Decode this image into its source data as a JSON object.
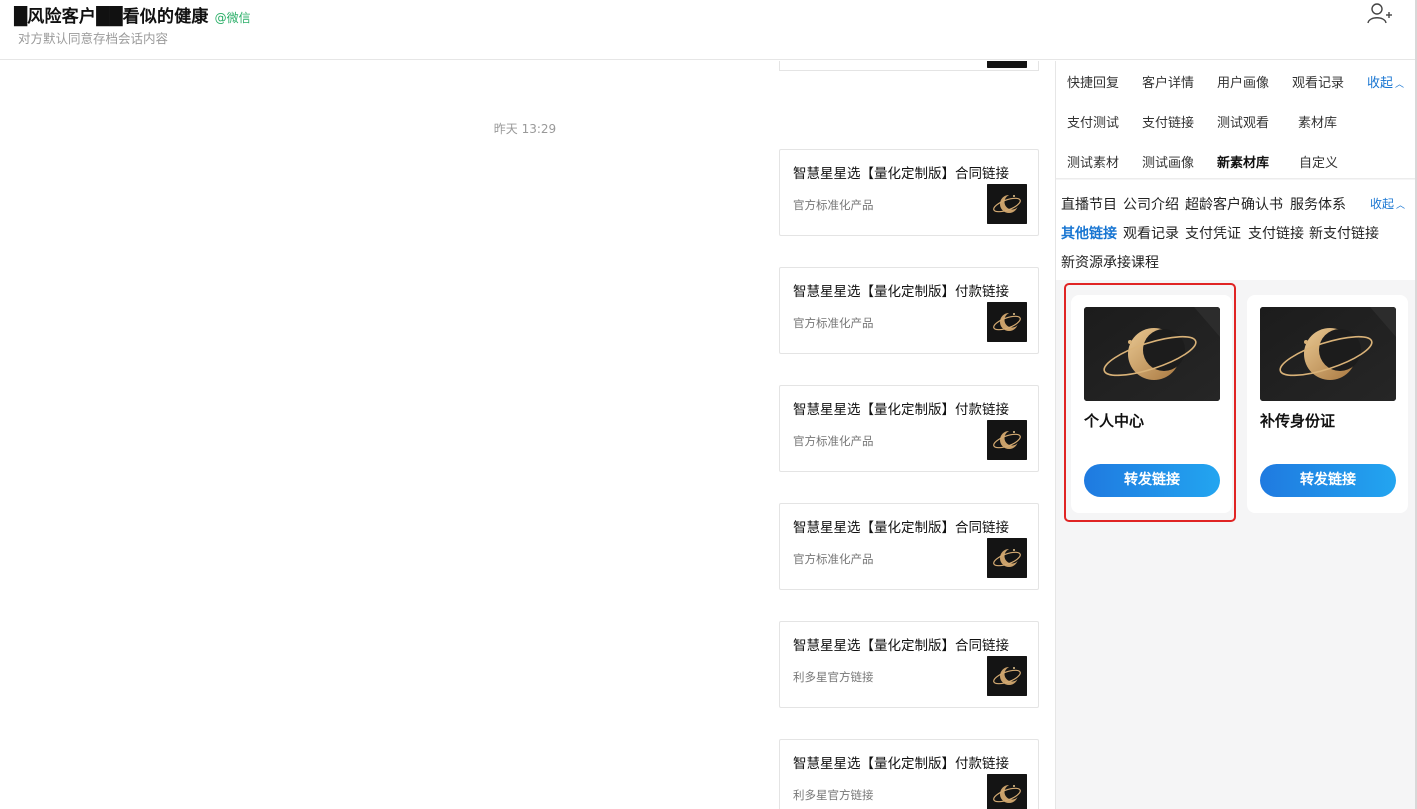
{
  "header": {
    "title": "█风险客户██看似的健康",
    "channel_tag": "@微信",
    "subtitle": "对方默认同意存档会话内容",
    "add_member_icon": "add-user-icon"
  },
  "chat": {
    "timestamp": "昨天 13:29",
    "cards": [
      {
        "title": "智慧星星选【量化定制版】合同链接",
        "subtitle": "官方标准化产品"
      },
      {
        "title": "智慧星星选【量化定制版】付款链接",
        "subtitle": "官方标准化产品"
      },
      {
        "title": "智慧星星选【量化定制版】付款链接",
        "subtitle": "官方标准化产品"
      },
      {
        "title": "智慧星星选【量化定制版】合同链接",
        "subtitle": "官方标准化产品"
      },
      {
        "title": "智慧星星选【量化定制版】合同链接",
        "subtitle": "利多星官方链接"
      },
      {
        "title": "智慧星星选【量化定制版】付款链接",
        "subtitle": "利多星官方链接"
      }
    ]
  },
  "panel": {
    "tabs": [
      {
        "label": "快捷回复",
        "active": false
      },
      {
        "label": "客户详情",
        "active": false
      },
      {
        "label": "用户画像",
        "active": false
      },
      {
        "label": "观看记录",
        "active": false
      },
      {
        "label": "支付测试",
        "active": false
      },
      {
        "label": "支付链接",
        "active": false
      },
      {
        "label": "测试观看",
        "active": false
      },
      {
        "label": "素材库",
        "active": false
      },
      {
        "label": "测试素材",
        "active": false
      },
      {
        "label": "测试画像",
        "active": false
      },
      {
        "label": "新素材库",
        "active": true
      },
      {
        "label": "自定义",
        "active": false
      }
    ],
    "tabs_collapse_label": "收起",
    "categories": [
      {
        "label": "直播节目",
        "active": false
      },
      {
        "label": "公司介绍",
        "active": false
      },
      {
        "label": "超龄客户确认书",
        "active": false
      },
      {
        "label": "服务体系",
        "active": false
      },
      {
        "label": "其他链接",
        "active": true
      },
      {
        "label": "观看记录",
        "active": false
      },
      {
        "label": "支付凭证",
        "active": false
      },
      {
        "label": "支付链接",
        "active": false
      },
      {
        "label": "新支付链接",
        "active": false
      },
      {
        "label": "新资源承接课程",
        "active": false
      }
    ],
    "categories_collapse_label": "收起",
    "materials": [
      {
        "name": "个人中心",
        "button": "转发链接",
        "highlighted": true
      },
      {
        "name": "补传身份证",
        "button": "转发链接",
        "highlighted": false
      }
    ],
    "accent_color": "#1976d2",
    "highlight_color": "#e02424"
  }
}
